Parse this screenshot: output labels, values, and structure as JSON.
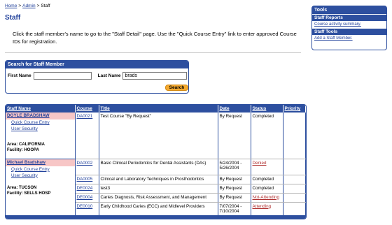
{
  "breadcrumb": {
    "home": "Home",
    "admin": "Admin",
    "current": "Staff",
    "sep": ">"
  },
  "page": {
    "title": "Staff",
    "intro": "Click the staff member's name to go to the \"Staff Detail\" page. Use the \"Quick Course Entry\" link to enter approved Course IDs for registration."
  },
  "search": {
    "header": "Search for Staff Member",
    "first_name_label": "First Name",
    "first_name_value": "",
    "last_name_label": "Last Name",
    "last_name_value": "brads",
    "button_label": "Search"
  },
  "tools": {
    "header": "Tools",
    "reports_header": "Staff Reports",
    "reports_link": "Course activity summary.",
    "tools_header": "Staff Tools",
    "tools_link": "Add a Staff Member."
  },
  "results": {
    "columns": [
      "Staff Name",
      "Course",
      "Title",
      "Date",
      "Status",
      "Priority"
    ],
    "staff": [
      {
        "name": "DOYLE BRADSHAW",
        "quick_course": "Quick Course Entry",
        "user_security": "User Security",
        "area": "Area: CALIFORNIA",
        "facility": "Facility: HOOPA",
        "rows": [
          {
            "course": "DA0021",
            "title": "Test Course \"By Request\"",
            "date": "By Request",
            "status": "Completed",
            "status_link": false
          }
        ]
      },
      {
        "name": "Michael Bradshaw",
        "quick_course": "Quick Course Entry",
        "user_security": "User Security",
        "area": "Area: TUCSON",
        "facility": "Facility: SELLS HOSP",
        "rows": [
          {
            "course": "DA0002",
            "title": "Basic Clinical Periodontics for Dental Assistants (DAs)",
            "date": "5/24/2004 - 5/26/2004",
            "status": "Denied",
            "status_link": true
          },
          {
            "course": "DA0005",
            "title": "Clinical and Laboratory Techniques in Prosthodontics",
            "date": "By Request",
            "status": "Completed",
            "status_link": false
          },
          {
            "course": "DE0024",
            "title": "test3",
            "date": "By Request",
            "status": "Completed",
            "status_link": false
          },
          {
            "course": "DE0004",
            "title": "Caries Diagnosis, Risk Assessment, and Management",
            "date": "By Request",
            "status": "Not-Attending",
            "status_link": true
          },
          {
            "course": "DE0010",
            "title": "Early Childhood Caries (ECC) and Midlevel Providers",
            "date": "7/07/2004 - 7/10/2004",
            "status": "Attending",
            "status_link": true
          }
        ]
      }
    ]
  }
}
